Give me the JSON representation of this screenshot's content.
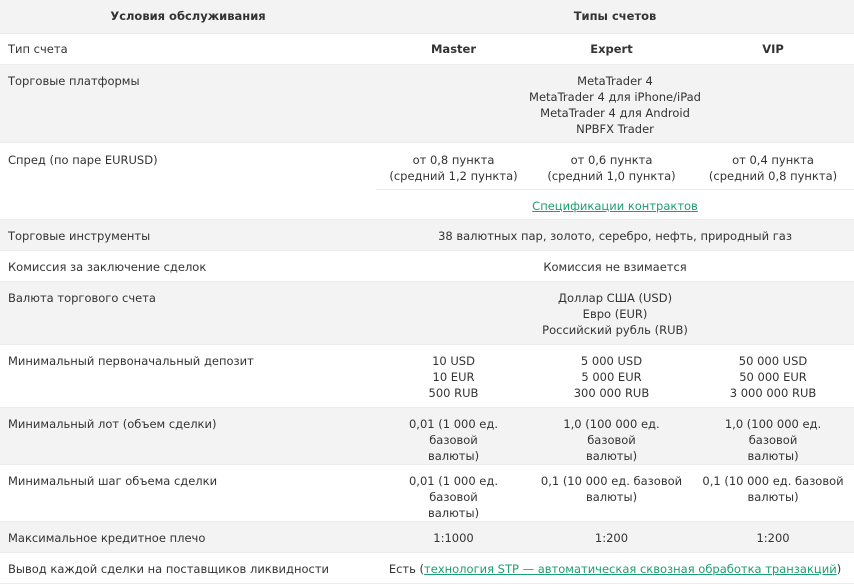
{
  "header": {
    "col1": "Условия обслуживания",
    "col2": "Типы счетов"
  },
  "account_type": {
    "label": "Тип счета",
    "master": "Master",
    "expert": "Expert",
    "vip": "VIP"
  },
  "platforms": {
    "label": "Торговые платформы",
    "items": [
      "MetaTrader 4",
      "MetaTrader 4 для iPhone/iPad",
      "MetaTrader 4 для Android",
      "NPBFX Trader"
    ]
  },
  "spread": {
    "label": "Спред (по паре EURUSD)",
    "master": [
      "от 0,8 пункта",
      "(средний 1,2 пункта)"
    ],
    "expert": [
      "от 0,6 пункта",
      "(средний 1,0 пункта)"
    ],
    "vip": [
      "от 0,4 пункта",
      "(средний 0,8 пункта)"
    ],
    "link": "Спецификации контрактов"
  },
  "instruments": {
    "label": "Торговые инструменты",
    "value": "38 валютных пар, золото, серебро, нефть, природный газ"
  },
  "commission": {
    "label": "Комиссия за заключение сделок",
    "value": "Комиссия не взимается"
  },
  "currency": {
    "label": "Валюта торгового счета",
    "items": [
      "Доллар США (USD)",
      "Евро (EUR)",
      "Российский рубль (RUB)"
    ]
  },
  "deposit": {
    "label": "Минимальный первоначальный депозит",
    "master": [
      "10 USD",
      "10 EUR",
      "500 RUB"
    ],
    "expert": [
      "5 000 USD",
      "5 000 EUR",
      "300 000 RUB"
    ],
    "vip": [
      "50 000 USD",
      "50 000 EUR",
      "3 000 000 RUB"
    ]
  },
  "min_lot": {
    "label": "Минимальный лот (объем сделки)",
    "master": [
      "0,01 (1 000 ед. базовой",
      "валюты)"
    ],
    "expert": [
      "1,0 (100 000 ед. базовой",
      "валюты)"
    ],
    "vip": [
      "1,0 (100 000 ед. базовой",
      "валюты)"
    ]
  },
  "min_step": {
    "label": "Минимальный шаг объема сделки",
    "master": [
      "0,01 (1 000 ед. базовой",
      "валюты)"
    ],
    "expert": [
      "0,1 (10 000 ед. базовой",
      "валюты)"
    ],
    "vip": [
      "0,1 (10 000 ед. базовой",
      "валюты)"
    ]
  },
  "leverage": {
    "label": "Максимальное кредитное плечо",
    "master": "1:1000",
    "expert": "1:200",
    "vip": "1:200"
  },
  "execution": {
    "label": "Вывод каждой сделки на поставщиков ликвидности",
    "prefix": "Есть (",
    "link": "технология STP — автоматическая сквозная обработка транзакций",
    "suffix": ")"
  }
}
